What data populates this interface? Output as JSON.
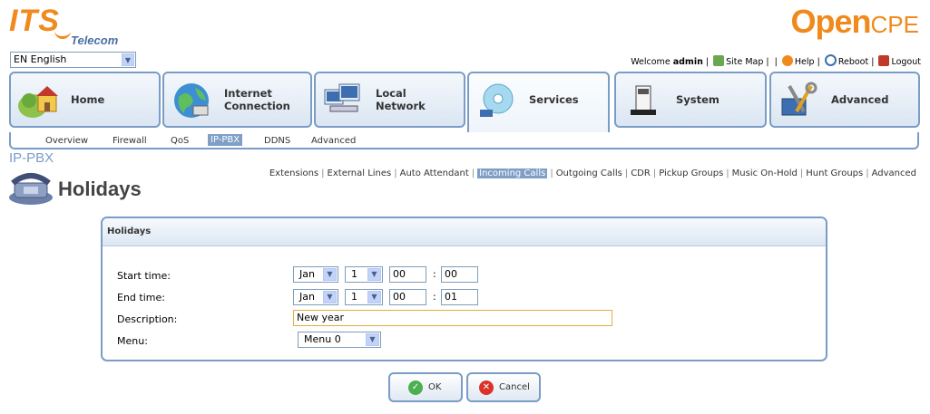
{
  "brand": {
    "its": "ITS",
    "telecom": "Telecom",
    "open": "Open",
    "cpe": "CPE"
  },
  "language": {
    "selected": "EN English"
  },
  "toplinks": {
    "welcome": "Welcome",
    "user": "admin",
    "sitemap": "Site Map",
    "help": "Help",
    "reboot": "Reboot",
    "logout": "Logout"
  },
  "tabs": [
    {
      "label": "Home",
      "icon": "home-icon"
    },
    {
      "label": "Internet\nConnection",
      "icon": "globe-icon"
    },
    {
      "label": "Local\nNetwork",
      "icon": "computers-icon"
    },
    {
      "label": "Services",
      "icon": "services-cd-icon"
    },
    {
      "label": "System",
      "icon": "device-icon"
    },
    {
      "label": "Advanced",
      "icon": "tools-icon"
    }
  ],
  "subnav": [
    "Overview",
    "Firewall",
    "QoS",
    "IP-PBX",
    "DDNS",
    "Advanced"
  ],
  "breadcrumb": "IP-PBX",
  "page_title": "Holidays",
  "subtabs": [
    "Extensions",
    "External Lines",
    "Auto Attendant",
    "Incoming Calls",
    "Outgoing Calls",
    "CDR",
    "Pickup Groups",
    "Music On-Hold",
    "Hunt Groups",
    "Advanced"
  ],
  "panel": {
    "title": "Holidays",
    "start_label": "Start time:",
    "end_label": "End time:",
    "desc_label": "Description:",
    "menu_label": "Menu:",
    "start": {
      "month": "Jan",
      "day": "1",
      "hour": "00",
      "minute": "00"
    },
    "end": {
      "month": "Jan",
      "day": "1",
      "hour": "00",
      "minute": "01"
    },
    "description": "New year",
    "menu": "Menu 0"
  },
  "buttons": {
    "ok": "OK",
    "cancel": "Cancel"
  },
  "colors": {
    "accent": "#7a9cc6",
    "brand_orange": "#f08a1c",
    "selected": "#7f9fc7"
  }
}
